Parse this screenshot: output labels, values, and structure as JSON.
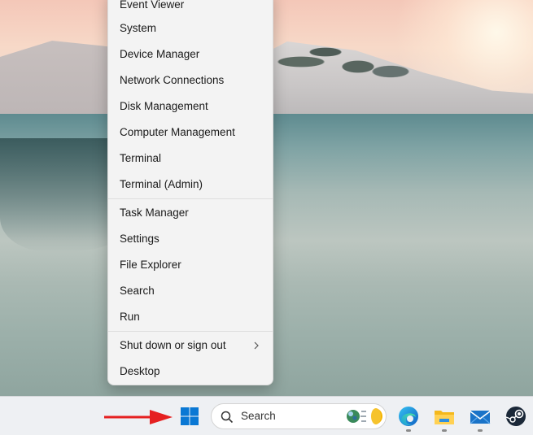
{
  "context_menu": {
    "items": [
      {
        "label": "Event Viewer"
      },
      {
        "label": "System"
      },
      {
        "label": "Device Manager"
      },
      {
        "label": "Network Connections"
      },
      {
        "label": "Disk Management"
      },
      {
        "label": "Computer Management"
      },
      {
        "label": "Terminal"
      },
      {
        "label": "Terminal (Admin)"
      },
      {
        "label": "Task Manager"
      },
      {
        "label": "Settings"
      },
      {
        "label": "File Explorer"
      },
      {
        "label": "Search"
      },
      {
        "label": "Run"
      },
      {
        "label": "Shut down or sign out",
        "has_submenu": true
      },
      {
        "label": "Desktop"
      }
    ],
    "submenu_icon": "chevron-right-icon"
  },
  "taskbar": {
    "start_icon": "windows-start-icon",
    "search": {
      "placeholder": "Search",
      "icon": "search-icon"
    },
    "pinned_apps": [
      {
        "name": "Microsoft Edge",
        "icon": "edge-icon"
      },
      {
        "name": "File Explorer",
        "icon": "folder-icon"
      },
      {
        "name": "Mail",
        "icon": "mail-icon"
      },
      {
        "name": "Steam",
        "icon": "steam-icon"
      }
    ]
  },
  "annotation": {
    "arrow_color": "#e52020"
  },
  "colors": {
    "menu_background": "#f3f3f3",
    "taskbar_background": "#eef0f3",
    "windows_blue": "#0a78d4"
  }
}
